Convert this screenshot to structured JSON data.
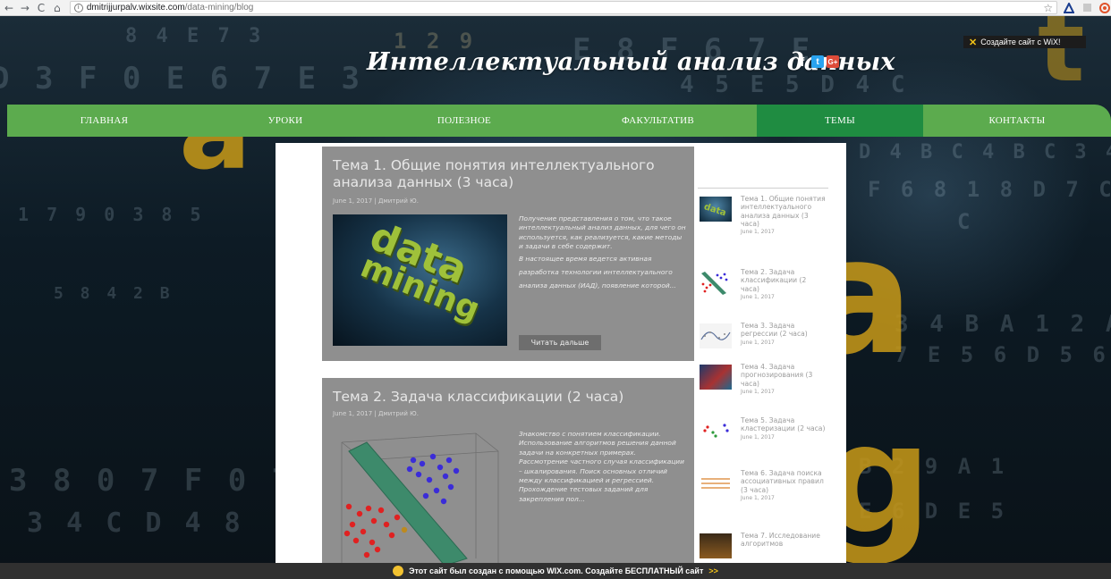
{
  "browser": {
    "url_host": "dmitrijjurpalv.wixsite.com",
    "url_path": "/data-mining/blog",
    "back": "←",
    "forward": "→",
    "reload": "C",
    "home": "⌂",
    "info": "i",
    "star": "☆"
  },
  "wix_top": {
    "x": "✕",
    "label": "Создайте сайт с WiX!"
  },
  "site_title": "Интеллектуальный анализ данных",
  "social": {
    "fb": "f",
    "tw": "t",
    "gp": "G+"
  },
  "menu": [
    {
      "label": "ГЛАВНАЯ",
      "active": false
    },
    {
      "label": "УРОКИ",
      "active": false
    },
    {
      "label": "ПОЛЕЗНОЕ",
      "active": false
    },
    {
      "label": "ФАКУЛЬТАТИВ",
      "active": false
    },
    {
      "label": "ТЕМЫ",
      "active": true
    },
    {
      "label": "КОНТАКТЫ",
      "active": false
    }
  ],
  "posts": [
    {
      "title": "Тема 1. Общие понятия интеллектуального анализа данных (3 часа)",
      "meta": "June 1, 2017 | Дмитрий Ю.",
      "excerpt_italic": "Получение представления о том, что такое интеллектуальный анализ данных, для чего он используется, как реализуется, какие методы и задачи в себе содержит.",
      "excerpt_tail": "В настоящее время ведется активная разработка технологии интеллектуального анализа данных (ИАД), появление которой...",
      "read_more": "Читать дальше"
    },
    {
      "title": "Тема 2. Задача классификации (2 часа)",
      "meta": "June 1, 2017 | Дмитрий Ю.",
      "excerpt_italic": "Знакомство с понятием классификации. Использование алгоритмов решения данной задачи на конкретных примерах. Рассмотрение частного случая классификации – шкалирования. Поиск основных отличий между классификацией и регрессией. Прохождение тестовых заданий для закрепления пол..."
    }
  ],
  "image_words": {
    "data": "data",
    "mining": "mining"
  },
  "sidebar": [
    {
      "title": "Тема 1. Общие понятия интеллектуального анализа данных (3 часа)",
      "date": "June 1, 2017"
    },
    {
      "title": "Тема 2. Задача классификации (2 часа)",
      "date": "June 1, 2017"
    },
    {
      "title": "Тема 3. Задача регрессии (2 часа)",
      "date": "June 1, 2017"
    },
    {
      "title": "Тема 4. Задача прогнозирования (3 часа)",
      "date": "June 1, 2017"
    },
    {
      "title": "Тема 5. Задача кластеризации (2 часа)",
      "date": "June 1, 2017"
    },
    {
      "title": "Тема 6. Задача поиска ассоциативных правил (3 часа)",
      "date": "June 1, 2017"
    },
    {
      "title": "Тема 7. Исследование алгоритмов",
      "date": ""
    }
  ],
  "wix_bottom": {
    "text": "Этот сайт был создан с помощью WIX.com. Создайте БЕСПЛАТНЫЙ сайт",
    "arrow": ">>"
  },
  "colors": {
    "menu_green": "#5cab4e",
    "menu_active": "#1f8c41",
    "post_bg": "#8f8f8f",
    "accent_yellow": "#c99a18"
  }
}
